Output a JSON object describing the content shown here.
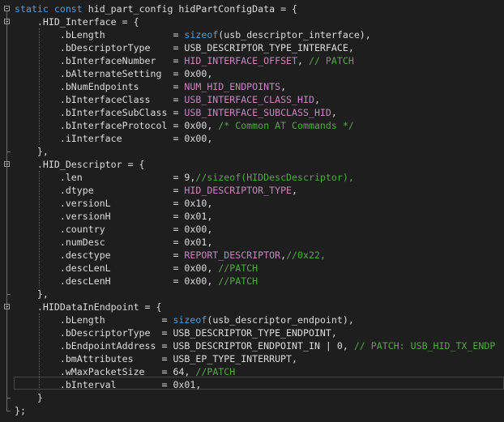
{
  "lines": [
    {
      "tokens": [
        {
          "t": "static const",
          "c": "kw"
        },
        {
          "t": " hid_part_config hidPartConfigData = {"
        }
      ]
    },
    {
      "tokens": [
        {
          "t": "    .HID_Interface = {"
        }
      ]
    },
    {
      "tokens": [
        {
          "t": "        .bLength            = "
        },
        {
          "t": "sizeof",
          "c": "kw"
        },
        {
          "t": "(usb_descriptor_interface),"
        }
      ]
    },
    {
      "tokens": [
        {
          "t": "        .bDescriptorType    = USB_DESCRIPTOR_TYPE_INTERFACE,"
        }
      ]
    },
    {
      "tokens": [
        {
          "t": "        .bInterfaceNumber   = "
        },
        {
          "t": "HID_INTERFACE_OFFSET",
          "c": "macro"
        },
        {
          "t": ", "
        },
        {
          "t": "// PATCH",
          "c": "cmt"
        }
      ]
    },
    {
      "tokens": [
        {
          "t": "        .bAlternateSetting  = 0x00,"
        }
      ]
    },
    {
      "tokens": [
        {
          "t": "        .bNumEndpoints      = "
        },
        {
          "t": "NUM_HID_ENDPOINTS",
          "c": "macro"
        },
        {
          "t": ","
        }
      ]
    },
    {
      "tokens": [
        {
          "t": "        .bInterfaceClass    = "
        },
        {
          "t": "USB_INTERFACE_CLASS_HID",
          "c": "macro"
        },
        {
          "t": ","
        }
      ]
    },
    {
      "tokens": [
        {
          "t": "        .bInterfaceSubClass = "
        },
        {
          "t": "USB_INTERFACE_SUBCLASS_HID",
          "c": "macro"
        },
        {
          "t": ","
        }
      ]
    },
    {
      "tokens": [
        {
          "t": "        .bInterfaceProtocol = 0x00, "
        },
        {
          "t": "/* Common AT Commands */",
          "c": "cmt"
        }
      ]
    },
    {
      "tokens": [
        {
          "t": "        .iInterface         = 0x00,"
        }
      ]
    },
    {
      "tokens": [
        {
          "t": "    },"
        }
      ]
    },
    {
      "tokens": [
        {
          "t": "    .HID_Descriptor = {"
        }
      ]
    },
    {
      "tokens": [
        {
          "t": "        .len                = 9,"
        },
        {
          "t": "//sizeof(HIDDescDescriptor),",
          "c": "cmt"
        }
      ]
    },
    {
      "tokens": [
        {
          "t": "        .dtype              = "
        },
        {
          "t": "HID_DESCRIPTOR_TYPE",
          "c": "macro"
        },
        {
          "t": ","
        }
      ]
    },
    {
      "tokens": [
        {
          "t": "        .versionL           = 0x10,"
        }
      ]
    },
    {
      "tokens": [
        {
          "t": "        .versionH           = 0x01,"
        }
      ]
    },
    {
      "tokens": [
        {
          "t": "        .country            = 0x00,"
        }
      ]
    },
    {
      "tokens": [
        {
          "t": "        .numDesc            = 0x01,"
        }
      ]
    },
    {
      "tokens": [
        {
          "t": "        .desctype           = "
        },
        {
          "t": "REPORT_DESCRIPTOR",
          "c": "macro"
        },
        {
          "t": ","
        },
        {
          "t": "//0x22,",
          "c": "cmt"
        }
      ]
    },
    {
      "tokens": [
        {
          "t": "        .descLenL           = 0x00, "
        },
        {
          "t": "//PATCH",
          "c": "cmt"
        }
      ]
    },
    {
      "tokens": [
        {
          "t": "        .descLenH           = 0x00, "
        },
        {
          "t": "//PATCH",
          "c": "cmt"
        }
      ]
    },
    {
      "tokens": [
        {
          "t": "    },"
        }
      ]
    },
    {
      "tokens": [
        {
          "t": "    .HIDDataInEndpoint = {"
        }
      ]
    },
    {
      "tokens": [
        {
          "t": "        .bLength          = "
        },
        {
          "t": "sizeof",
          "c": "kw"
        },
        {
          "t": "(usb_descriptor_endpoint),"
        }
      ]
    },
    {
      "tokens": [
        {
          "t": "        .bDescriptorType  = USB_DESCRIPTOR_TYPE_ENDPOINT,"
        }
      ]
    },
    {
      "tokens": [
        {
          "t": "        .bEndpointAddress = USB_DESCRIPTOR_ENDPOINT_IN | 0, "
        },
        {
          "t": "// PATCH: USB_HID_TX_ENDP",
          "c": "cmt"
        }
      ]
    },
    {
      "tokens": [
        {
          "t": "        .bmAttributes     = USB_EP_TYPE_INTERRUPT,"
        }
      ]
    },
    {
      "tokens": [
        {
          "t": "        .wMaxPacketSize   = 64, "
        },
        {
          "t": "//PATCH",
          "c": "cmt"
        }
      ]
    },
    {
      "tokens": [
        {
          "t": "        .bInterval        = 0x01,"
        }
      ]
    },
    {
      "tokens": [
        {
          "t": "    }"
        }
      ]
    },
    {
      "tokens": [
        {
          "t": "};"
        }
      ]
    }
  ],
  "folds": [
    {
      "line": 0,
      "end": 31
    },
    {
      "line": 1,
      "end": 11
    },
    {
      "line": 12,
      "end": 22
    },
    {
      "line": 23,
      "end": 30
    }
  ]
}
